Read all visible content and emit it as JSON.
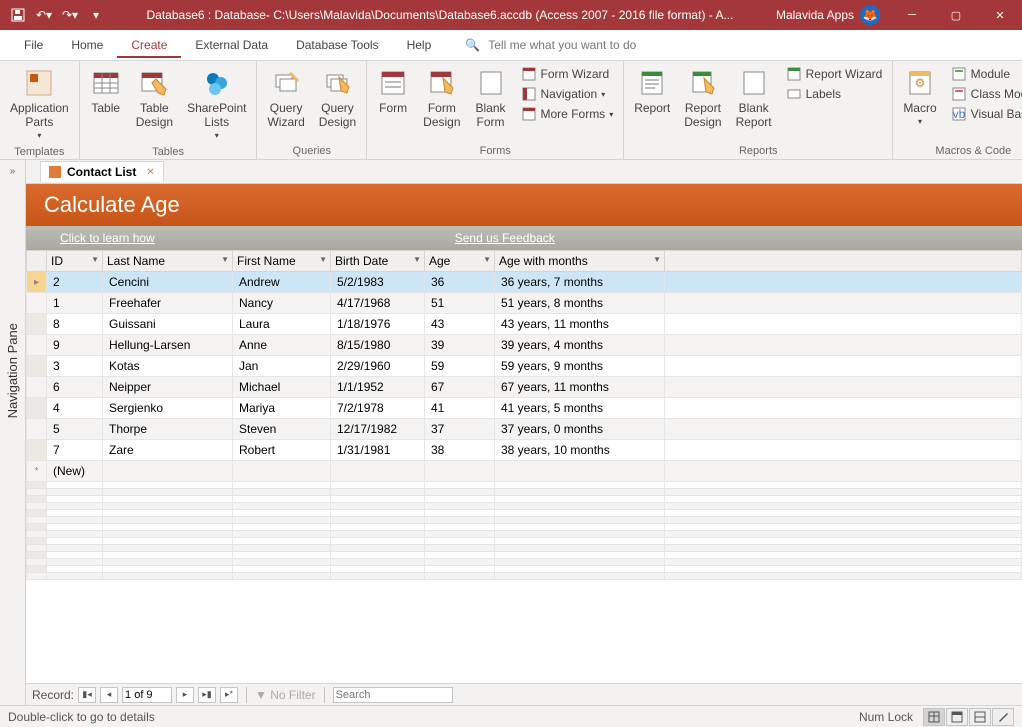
{
  "titlebar": {
    "title": "Database6 : Database- C:\\Users\\Malavida\\Documents\\Database6.accdb (Access 2007 - 2016 file format) -  A...",
    "app": "Malavida Apps"
  },
  "menu": {
    "file": "File",
    "home": "Home",
    "create": "Create",
    "external": "External Data",
    "dbtools": "Database Tools",
    "help": "Help",
    "tellme": "Tell me what you want to do"
  },
  "ribbon": {
    "groups": {
      "templates": "Templates",
      "tables": "Tables",
      "queries": "Queries",
      "forms": "Forms",
      "reports": "Reports",
      "macros": "Macros & Code"
    },
    "btns": {
      "appparts": "Application\nParts",
      "table": "Table",
      "tabledesign": "Table\nDesign",
      "splists": "SharePoint\nLists",
      "qwizard": "Query\nWizard",
      "qdesign": "Query\nDesign",
      "form": "Form",
      "formdesign": "Form\nDesign",
      "blankform": "Blank\nForm",
      "formwizard": "Form Wizard",
      "navigation": "Navigation",
      "moreforms": "More Forms",
      "report": "Report",
      "reportdesign": "Report\nDesign",
      "blankreport": "Blank\nReport",
      "reportwizard": "Report Wizard",
      "labels": "Labels",
      "macro": "Macro",
      "module": "Module",
      "classmodule": "Class Module",
      "visualbasic": "Visual Basic"
    }
  },
  "navpane": "Navigation Pane",
  "tab": {
    "name": "Contact List"
  },
  "form": {
    "title": "Calculate Age",
    "learn": "Click to learn how",
    "feedback": "Send us Feedback"
  },
  "columns": {
    "id": "ID",
    "ln": "Last Name",
    "fn": "First Name",
    "bd": "Birth Date",
    "age": "Age",
    "awm": "Age with months"
  },
  "rows": [
    {
      "id": "2",
      "ln": "Cencini",
      "fn": "Andrew",
      "bd": "5/2/1983",
      "age": "36",
      "awm": "36 years, 7 months"
    },
    {
      "id": "1",
      "ln": "Freehafer",
      "fn": "Nancy",
      "bd": "4/17/1968",
      "age": "51",
      "awm": "51 years, 8 months"
    },
    {
      "id": "8",
      "ln": "Guissani",
      "fn": "Laura",
      "bd": "1/18/1976",
      "age": "43",
      "awm": "43 years, 11 months"
    },
    {
      "id": "9",
      "ln": "Hellung-Larsen",
      "fn": "Anne",
      "bd": "8/15/1980",
      "age": "39",
      "awm": "39 years, 4 months"
    },
    {
      "id": "3",
      "ln": "Kotas",
      "fn": "Jan",
      "bd": "2/29/1960",
      "age": "59",
      "awm": "59 years, 9 months"
    },
    {
      "id": "6",
      "ln": "Neipper",
      "fn": "Michael",
      "bd": "1/1/1952",
      "age": "67",
      "awm": "67 years, 11 months"
    },
    {
      "id": "4",
      "ln": "Sergienko",
      "fn": "Mariya",
      "bd": "7/2/1978",
      "age": "41",
      "awm": "41 years, 5 months"
    },
    {
      "id": "5",
      "ln": "Thorpe",
      "fn": "Steven",
      "bd": "12/17/1982",
      "age": "37",
      "awm": "37 years, 0 months"
    },
    {
      "id": "7",
      "ln": "Zare",
      "fn": "Robert",
      "bd": "1/31/1981",
      "age": "38",
      "awm": "38 years, 10 months"
    }
  ],
  "newrow": "(New)",
  "recordnav": {
    "label": "Record:",
    "pos": "1 of 9",
    "nofilter": "No Filter",
    "search": "Search"
  },
  "status": {
    "msg": "Double-click to go to details",
    "numlock": "Num Lock"
  }
}
